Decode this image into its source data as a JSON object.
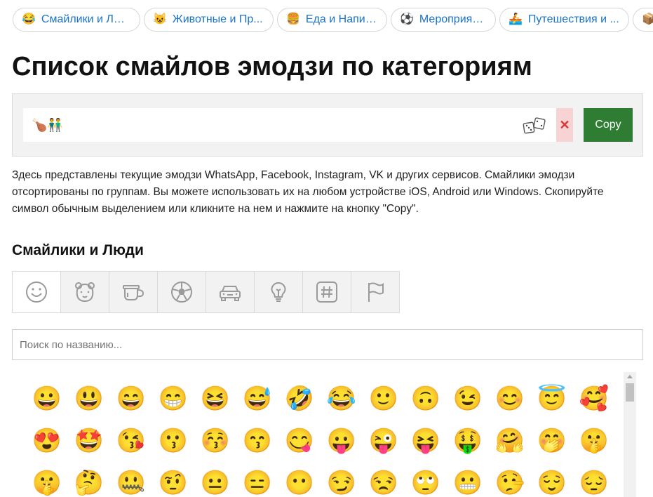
{
  "pills": [
    {
      "emoji": "😂",
      "label": "Смайлики и Люди"
    },
    {
      "emoji": "😺",
      "label": "Животные и Пр..."
    },
    {
      "emoji": "🍔",
      "label": "Еда и Напитки"
    },
    {
      "emoji": "⚽",
      "label": "Мероприятия"
    },
    {
      "emoji": "🚣",
      "label": "Путешествия и ..."
    },
    {
      "emoji": "📦",
      "label": ""
    }
  ],
  "page_title": "Список смайлов эмодзи по категориям",
  "copy_box": {
    "value": "🍗👬",
    "clear_label": "✕",
    "copy_label": "Copy"
  },
  "description": "Здесь представлены текущие эмодзи WhatsApp, Facebook, Instagram, VK и других сервисов. Смайлики эмодзи отсортированы по группам. Вы можете использовать их на любом устройстве iOS, Android или Windows. Скопируйте символ обычным выделением или кликните на нем и нажмите на кнопку \"Copy\".",
  "section_title": "Смайлики и Люди",
  "tabs": [
    {
      "icon": "smiley-icon",
      "active": true
    },
    {
      "icon": "bear-icon",
      "active": false
    },
    {
      "icon": "cup-icon",
      "active": false
    },
    {
      "icon": "ball-icon",
      "active": false
    },
    {
      "icon": "car-icon",
      "active": false
    },
    {
      "icon": "bulb-icon",
      "active": false
    },
    {
      "icon": "hash-icon",
      "active": false
    },
    {
      "icon": "flag-icon",
      "active": false
    }
  ],
  "search": {
    "placeholder": "Поиск по названию..."
  },
  "emoji_rows": [
    [
      "😀",
      "😃",
      "😄",
      "😁",
      "😆",
      "😅",
      "🤣",
      "😂",
      "🙂",
      "🙃",
      "😉",
      "😊",
      "😇",
      "🥰"
    ],
    [
      "😍",
      "🤩",
      "😘",
      "😗",
      "😚",
      "😙",
      "😋",
      "😛",
      "😜",
      "😝",
      "🤑",
      "🤗",
      "🤭",
      "🤫"
    ],
    [
      "🤫",
      "🤔",
      "🤐",
      "🤨",
      "😐",
      "😑",
      "😶",
      "😏",
      "😒",
      "🙄",
      "😬",
      "🤥",
      "😌",
      "😔"
    ]
  ],
  "colors": {
    "link": "#1a73c8",
    "copy_button": "#2e7d32",
    "clear_button_bg": "#f8d3d3"
  }
}
